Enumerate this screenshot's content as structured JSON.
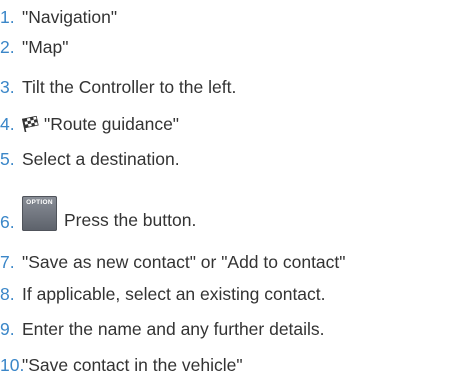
{
  "colors": {
    "number": "#3a86c8",
    "text": "#333333",
    "button_bg": "#6f747d"
  },
  "steps": [
    {
      "num": "1.",
      "text": "\"Navigation\""
    },
    {
      "num": "2.",
      "text": "\"Map\""
    },
    {
      "num": "3.",
      "text": "Tilt the Controller to the left."
    },
    {
      "num": "4.",
      "icon": "checkered-flag-icon",
      "text": "\"Route guidance\""
    },
    {
      "num": "5.",
      "text": "Select a destination."
    },
    {
      "num": "6.",
      "button_label": "OPTION",
      "text": "Press the button."
    },
    {
      "num": "7.",
      "text": "\"Save as new contact\" or \"Add to contact\""
    },
    {
      "num": "8.",
      "text": "If applicable, select an existing contact."
    },
    {
      "num": "9.",
      "text": "Enter the name and any further details."
    },
    {
      "num": "10.",
      "text": "\"Save contact in the vehicle\""
    }
  ]
}
